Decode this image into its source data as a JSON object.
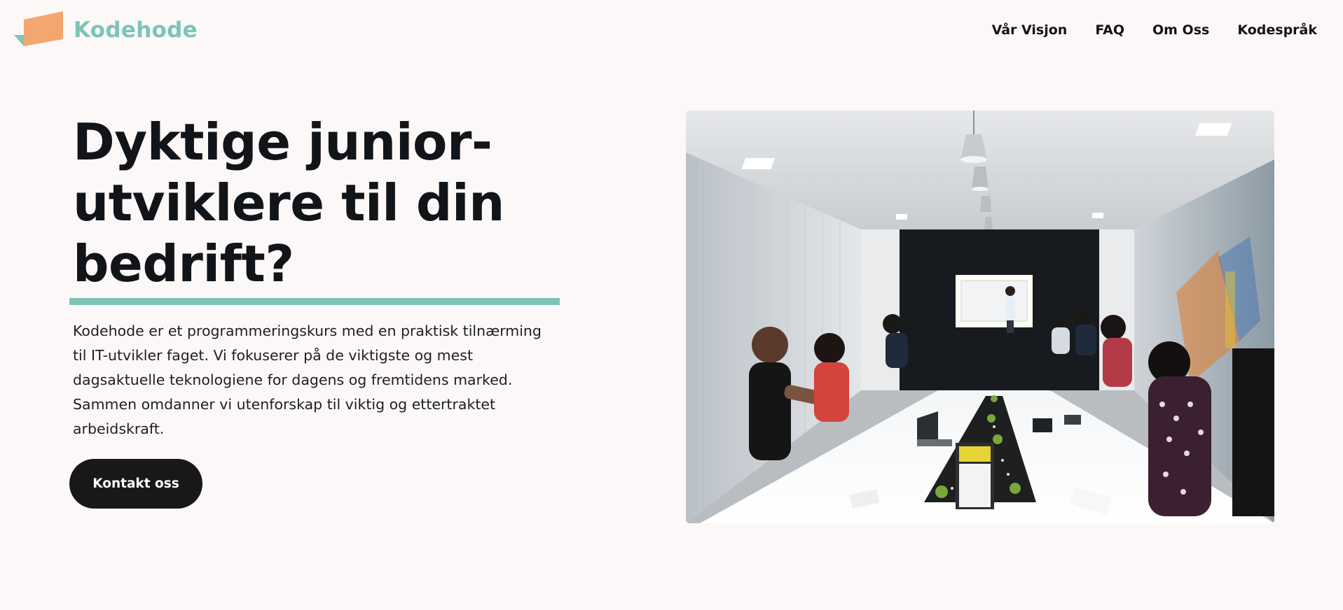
{
  "brand": {
    "name": "Kodehode",
    "logo_icon": "folded-paper-logo-icon",
    "color": "#7dc4b8",
    "logo_orange": "#f4a671",
    "logo_teal": "#7dc4b8"
  },
  "nav": {
    "items": [
      {
        "label": "Vår Visjon"
      },
      {
        "label": "FAQ"
      },
      {
        "label": "Om Oss"
      },
      {
        "label": "Kodespråk"
      }
    ]
  },
  "hero": {
    "title": "Dyktige junior-utviklere til din bedrift?",
    "description": "Kodehode er et programmeringskurs med en praktisk tilnærming til IT-utvikler faget. Vi fokuserer på de viktigste og mest dagsaktuelle teknologiene for dagens og fremtidens marked. Sammen omdanner vi utenforskap til viktig og ettertraktet arbeidskraft.",
    "cta_label": "Kontakt oss",
    "image_icon": "meeting-room-photo",
    "accent_color": "#7dc4b8",
    "button_color": "#181818",
    "background_color": "#fdf8f8"
  }
}
